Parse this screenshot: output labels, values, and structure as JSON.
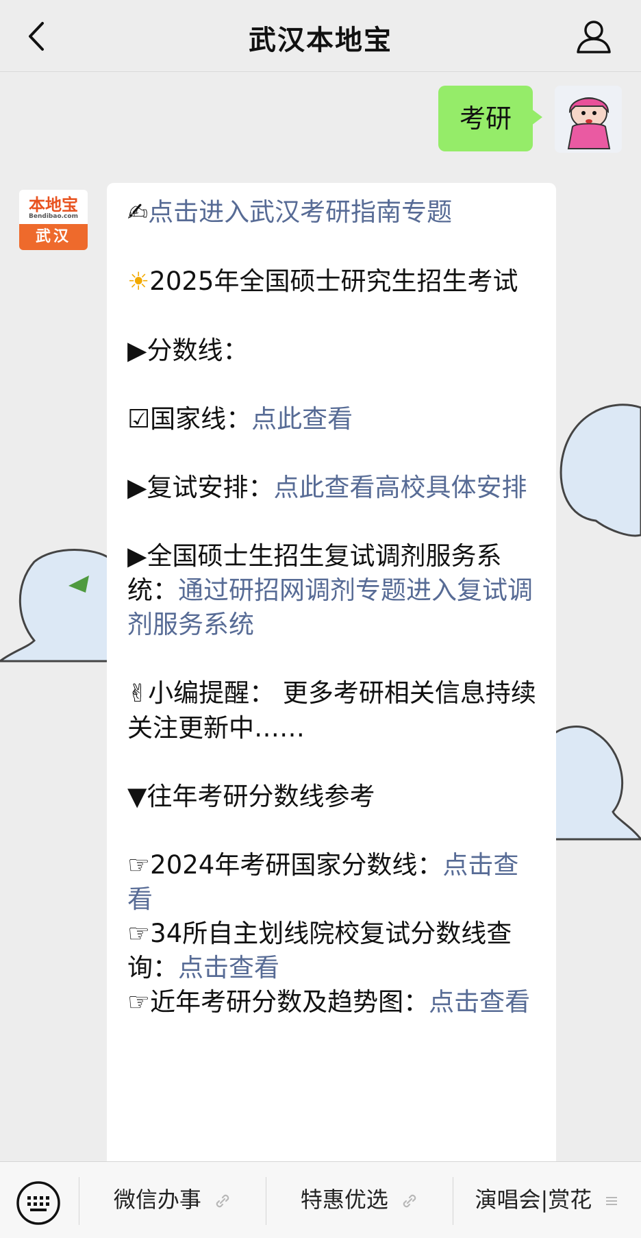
{
  "header": {
    "title": "武汉本地宝"
  },
  "user_message": {
    "text": "考研"
  },
  "bot": {
    "logo_cn": "本地宝",
    "logo_en": "Bendibao.com",
    "logo_city": "武汉"
  },
  "reply": {
    "l1_emoji": "✍",
    "l1_link": "点击进入武汉考研指南专题",
    "l2_emoji": "☀",
    "l2_text": "2025年全国硕士研究生招生考试",
    "l3_text": "▶分数线：",
    "l4_text": "☑国家线：",
    "l4_link": "点此查看",
    "l5_text": "▶复试安排：",
    "l5_link": "点此查看高校具体安排",
    "l6_text": "▶全国硕士生招生复试调剂服务系统：",
    "l6_link": "通过研招网调剂专题进入复试调剂服务系统",
    "l7_emoji": "✌",
    "l7_text": "小编提醒：  更多考研相关信息持续关注更新中……",
    "l8_text": "▼往年考研分数线参考",
    "l9_text": "☞2024年考研国家分数线：",
    "l9_link": "点击查看",
    "l10_text": "☞34所自主划线院校复试分数线查询：",
    "l10_link": "点击查看",
    "l11_text": "☞近年考研分数及趋势图：",
    "l11_link": "点击查看"
  },
  "bottom_menu": {
    "item1": "微信办事",
    "item2": "特惠优选",
    "item3": "演唱会|赏花",
    "item1_icon": "link-icon",
    "item2_icon": "link-icon",
    "item3_icon": "menu-lines-icon"
  }
}
